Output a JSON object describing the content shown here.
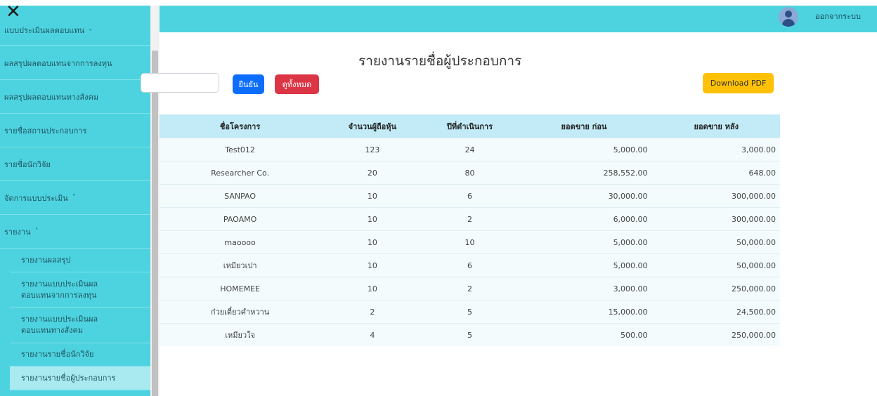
{
  "topbar": {
    "logout_label": "ออกจากระบบ"
  },
  "sidebar": {
    "close_glyph": "✕",
    "items": [
      {
        "label": "แบบประเมินผลตอบแทน",
        "chevron": "˅"
      },
      {
        "label": "ผลสรุปผลตอบแทนจากการลงทุน"
      },
      {
        "label": "ผลสรุปผลตอบแทนทางสังคม"
      },
      {
        "label": "รายชื่อสถานประกอบการ"
      },
      {
        "label": "รายชื่อนักวิจัย"
      },
      {
        "label": "จัดการแบบประเมิน",
        "chevron": "˅"
      },
      {
        "label": "รายงาน",
        "chevron": "˄"
      }
    ],
    "sub_items": [
      {
        "label": "รายงานผลสรุป"
      },
      {
        "line1": "รายงานแบบประเมินผล",
        "line2": "ตอบแทนจากการลงทุน"
      },
      {
        "line1": "รายงานแบบประเมินผล",
        "line2": "ตอบแทนทางสังคม"
      },
      {
        "label": "รายงานรายชื่อนักวิจัย"
      },
      {
        "label": "รายงานรายชื่อผู้ประกอบการ"
      }
    ]
  },
  "main": {
    "title": "รายงานรายชื่อผู้ประกอบการ",
    "search": {
      "value": "",
      "placeholder": ""
    },
    "confirm_label": "ยืนยัน",
    "view_all_label": "ดูทั้งหมด",
    "download_label": "Download PDF"
  },
  "table": {
    "headers": [
      "ชื่อโครงการ",
      "จำนวนผู้ถือหุ้น",
      "ปีที่ดำเนินการ",
      "ยอดขาย ก่อน",
      "ยอดขาย หลัง"
    ],
    "rows": [
      [
        "Test012",
        "123",
        "24",
        "5,000.00",
        "3,000.00"
      ],
      [
        "Researcher Co.",
        "20",
        "80",
        "258,552.00",
        "648.00"
      ],
      [
        "SANPAO",
        "10",
        "6",
        "30,000.00",
        "300,000.00"
      ],
      [
        "PAOAMO",
        "10",
        "2",
        "6,000.00",
        "300,000.00"
      ],
      [
        "maoooo",
        "10",
        "10",
        "5,000.00",
        "50,000.00"
      ],
      [
        "เหมียวเปา",
        "10",
        "6",
        "5,000.00",
        "50,000.00"
      ],
      [
        "HOMEMEE",
        "10",
        "2",
        "3,000.00",
        "250,000.00"
      ],
      [
        "ก๋วยเตี๋ยวคำหวาน",
        "2",
        "5",
        "15,000.00",
        "24,500.00"
      ],
      [
        "เหมียวใจ",
        "4",
        "5",
        "500.00",
        "250,000.00"
      ]
    ]
  }
}
